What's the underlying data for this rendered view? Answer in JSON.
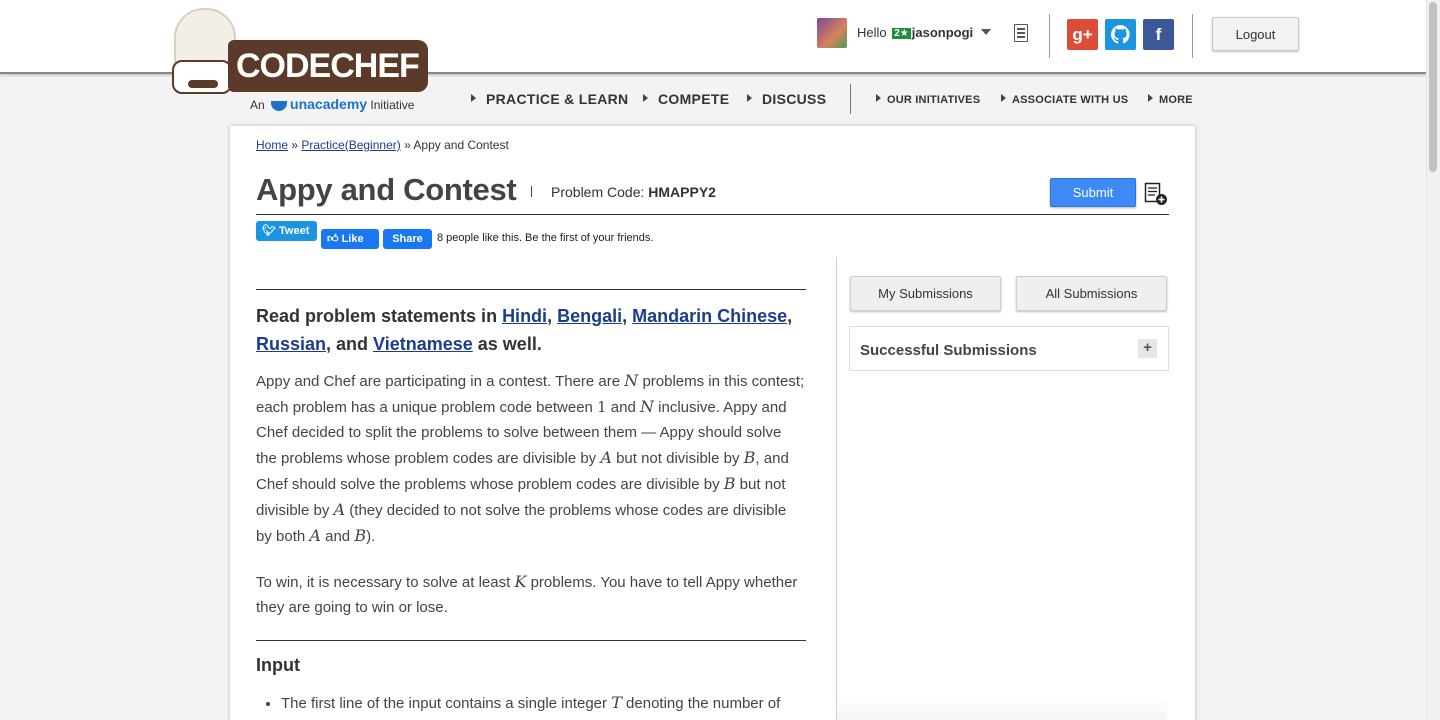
{
  "header": {
    "logo_text": "CODECHEF",
    "logo_sub_prefix": "An",
    "logo_sub_brand": "unacademy",
    "logo_sub_suffix": "Initiative",
    "hello_label": "Hello",
    "star_badge": "2★",
    "username": "jasonpogi",
    "logout_label": "Logout",
    "social": [
      {
        "name": "google-plus",
        "glyph": "g+",
        "color": "#dd4b39"
      },
      {
        "name": "github",
        "glyph": "◯",
        "color": "#1b95e0"
      },
      {
        "name": "facebook",
        "glyph": "f",
        "color": "#3b5998"
      }
    ]
  },
  "nav": {
    "practice": "PRACTICE & LEARN",
    "compete": "COMPETE",
    "discuss": "DISCUSS",
    "initiatives": "OUR INITIATIVES",
    "associate": "ASSOCIATE WITH US",
    "more": "MORE"
  },
  "breadcrumb": {
    "home": "Home",
    "sep1": " » ",
    "practice": "Practice(Beginner)",
    "sep2": " » ",
    "current": "Appy and Contest"
  },
  "problem": {
    "title": "Appy and Contest",
    "code_label": "Problem Code: ",
    "code": "HMAPPY2",
    "submit_label": "Submit"
  },
  "social_bar": {
    "tweet": "Tweet",
    "like": "Like",
    "share": "Share",
    "like_text": "8 people like this. Be the first of your friends."
  },
  "statement": {
    "lang_prefix": "Read problem statements in ",
    "langs": [
      "Hindi",
      "Bengali",
      "Mandarin Chinese",
      "Russian",
      "Vietnamese"
    ],
    "lang_suffix": " as well.",
    "input_heading": "Input"
  },
  "sidebar": {
    "my_submissions": "My Submissions",
    "all_submissions": "All Submissions",
    "successful_submissions": "Successful Submissions",
    "expand_glyph": "+"
  },
  "colors": {
    "accent": "#3d8af7",
    "brand_brown": "#5b3a29",
    "link": "#1a3e8c"
  }
}
